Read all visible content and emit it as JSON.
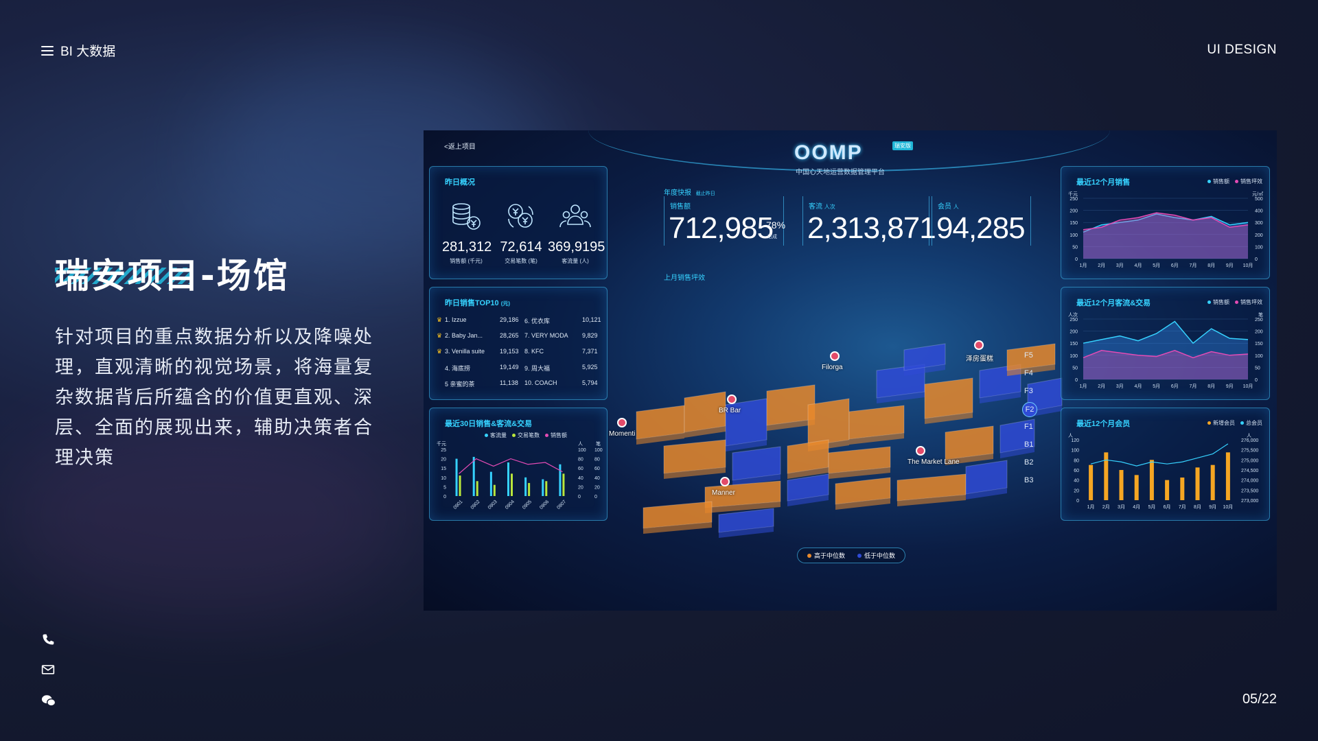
{
  "header": {
    "left_label": "BI 大数据",
    "right_label": "UI DESIGN"
  },
  "project": {
    "title": "瑞安项目-场馆",
    "description": "针对项目的重点数据分析以及降噪处理，直观清晰的视觉场景，将海量复杂数据背后所蕴含的价值更直观、深层、全面的展现出来，辅助决策者合理决策"
  },
  "page_indicator": "05/22",
  "side_icons": [
    "phone-icon",
    "mail-icon",
    "wechat-icon"
  ],
  "dashboard": {
    "back_label": "<返上项目",
    "logo": "OOMP",
    "logo_badge": "瑞安版",
    "subtitle": "中国心天地运营数据管理平台",
    "yesterday": {
      "title": "昨日概况",
      "kpis": [
        {
          "icon": "coins-icon",
          "value": "281,312",
          "label": "销售额 (千元)"
        },
        {
          "icon": "exchange-icon",
          "value": "72,614",
          "label": "交易笔数 (笔)"
        },
        {
          "icon": "people-icon",
          "value": "369,9195",
          "label": "客流量 (人)"
        }
      ]
    },
    "annual": {
      "title": "年度快报",
      "badge": "截止昨日",
      "sales_label": "销售额",
      "sales_value": "712,985",
      "sales_pct": "78%",
      "sales_pct_label": "达成",
      "traffic_label": "客流",
      "traffic_unit": "人次",
      "traffic_value": "2,313,871",
      "member_label": "会员",
      "member_unit": "人",
      "member_value": "94,285",
      "last_month_label": "上月销售坪效"
    },
    "top10": {
      "title": "昨日销售TOP10",
      "unit": "(元)",
      "left": [
        {
          "name": "1. Izzue",
          "value": "29,186"
        },
        {
          "name": "2. Baby Jan...",
          "value": "28,265"
        },
        {
          "name": "3. Venilla suite",
          "value": "19,153"
        },
        {
          "name": "4. 海底捞",
          "value": "19,149"
        },
        {
          "name": "5 亲蜜的茶",
          "value": "11,138"
        }
      ],
      "right": [
        {
          "name": "6. 优衣库",
          "value": "10,121"
        },
        {
          "name": "7. VERY MODA",
          "value": "9,829"
        },
        {
          "name": "8. KFC",
          "value": "7,371"
        },
        {
          "name": "9. 周大福",
          "value": "5,925"
        },
        {
          "name": "10. COACH",
          "value": "5,794"
        }
      ]
    },
    "map": {
      "floors": [
        "F5",
        "F4",
        "F3",
        "F2",
        "F1",
        "B1",
        "B2",
        "B3"
      ],
      "active_floor": "F2",
      "labels": [
        "Filorga",
        "BR Bar",
        "Momenti",
        "Manner",
        "The Market Lane",
        "泽房蛋糕"
      ],
      "legend_high": "高于中位数",
      "legend_low": "低于中位数",
      "colors": {
        "high": "#e8892c",
        "low": "#2f4bd6"
      }
    },
    "panels": {
      "sales12": {
        "title": "最近12个月销售",
        "legend": [
          "销售额",
          "销售坪效"
        ],
        "left_unit": "千元",
        "right_unit": "元/㎡"
      },
      "traffic12": {
        "title": "最近12个月客流&交易",
        "legend": [
          "销售额",
          "销售坪效"
        ],
        "left_unit": "人次",
        "right_unit": "笔"
      },
      "sales30": {
        "title": "最近30日销售&客流&交易",
        "legend": [
          "客流量",
          "交易笔数",
          "销售额"
        ],
        "left_unit": "千元",
        "mid_unit": "人",
        "right_unit": "笔"
      },
      "member12": {
        "title": "最近12个月会员",
        "legend": [
          "新增会员",
          "总会员"
        ],
        "left_unit": "人",
        "right_unit": "人"
      }
    }
  },
  "chart_data": [
    {
      "type": "area",
      "title": "最近12个月销售",
      "categories": [
        "1月",
        "2月",
        "3月",
        "4月",
        "5月",
        "6月",
        "7月",
        "8月",
        "9月",
        "10月"
      ],
      "series": [
        {
          "name": "销售额",
          "values": [
            110,
            140,
            150,
            160,
            185,
            170,
            160,
            175,
            140,
            150
          ]
        },
        {
          "name": "销售坪效",
          "values": [
            120,
            130,
            160,
            170,
            190,
            180,
            160,
            170,
            130,
            140
          ]
        }
      ],
      "ylim_left": [
        0,
        250
      ],
      "ylim_right": [
        0,
        500
      ]
    },
    {
      "type": "area",
      "title": "最近12个月客流&交易",
      "categories": [
        "1月",
        "2月",
        "3月",
        "4月",
        "5月",
        "6月",
        "7月",
        "8月",
        "9月",
        "10月"
      ],
      "series": [
        {
          "name": "销售额",
          "values": [
            150,
            165,
            180,
            160,
            190,
            240,
            150,
            210,
            170,
            165
          ]
        },
        {
          "name": "销售坪效",
          "values": [
            90,
            120,
            110,
            100,
            95,
            120,
            90,
            115,
            100,
            105
          ]
        }
      ],
      "ylim_left": [
        0,
        250
      ],
      "ylim_right": [
        0,
        250
      ]
    },
    {
      "type": "bar",
      "title": "最近30日销售&客流&交易",
      "categories": [
        "0901",
        "0902",
        "0903",
        "0904",
        "0905",
        "0906",
        "0907"
      ],
      "series": [
        {
          "name": "客流量",
          "values": [
            20,
            21,
            13,
            18,
            10,
            9,
            17
          ]
        },
        {
          "name": "交易笔数",
          "values": [
            11,
            8,
            6,
            12,
            7,
            8,
            12
          ]
        },
        {
          "name": "销售额",
          "values": [
            12,
            20,
            16,
            20,
            17,
            18,
            13
          ]
        }
      ],
      "ylim": [
        0,
        25
      ]
    },
    {
      "type": "bar",
      "title": "最近12个月会员",
      "categories": [
        "1月",
        "2月",
        "3月",
        "4月",
        "5月",
        "6月",
        "7月",
        "8月",
        "9月",
        "10月"
      ],
      "series": [
        {
          "name": "新增会员",
          "values": [
            70,
            95,
            60,
            50,
            80,
            40,
            45,
            65,
            70,
            95
          ]
        },
        {
          "name": "总会员",
          "values": [
            274800,
            275000,
            274900,
            274700,
            274900,
            274800,
            274900,
            275100,
            275300,
            275800
          ]
        }
      ],
      "ylim_left": [
        0,
        120
      ],
      "ylim_right": [
        273000,
        276000
      ]
    }
  ]
}
